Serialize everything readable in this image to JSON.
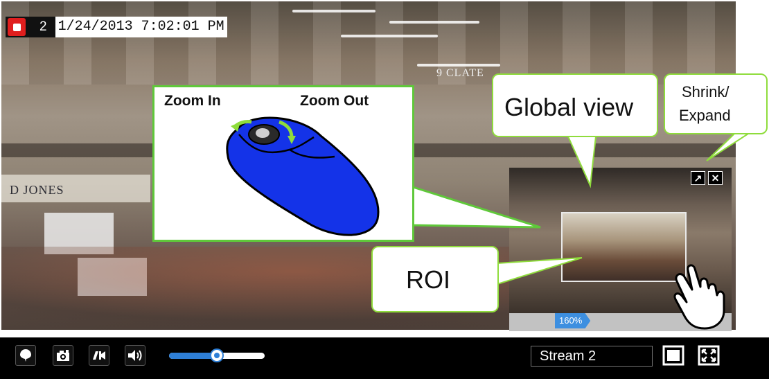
{
  "osd": {
    "camera_number": "2",
    "timestamp": "1/24/2013 7:02:01 PM"
  },
  "video_signs": {
    "left_shop": "D JONES",
    "top_shop": "9 CLATE"
  },
  "callouts": {
    "zoom_in": "Zoom In",
    "zoom_out": "Zoom Out",
    "global_view": "Global view",
    "shrink_expand_line1": "Shrink/",
    "shrink_expand_line2": "Expand",
    "roi": "ROI"
  },
  "global_view_panel": {
    "zoom_level": "160%"
  },
  "toolbar": {
    "stream_selected": "Stream 2",
    "volume_level_percent": 50
  },
  "colors": {
    "callout_border": "#8fdc3c",
    "rec_red": "#e01e1e",
    "accent_blue": "#2e7fd6",
    "mouse_blue": "#0f2fe6"
  }
}
